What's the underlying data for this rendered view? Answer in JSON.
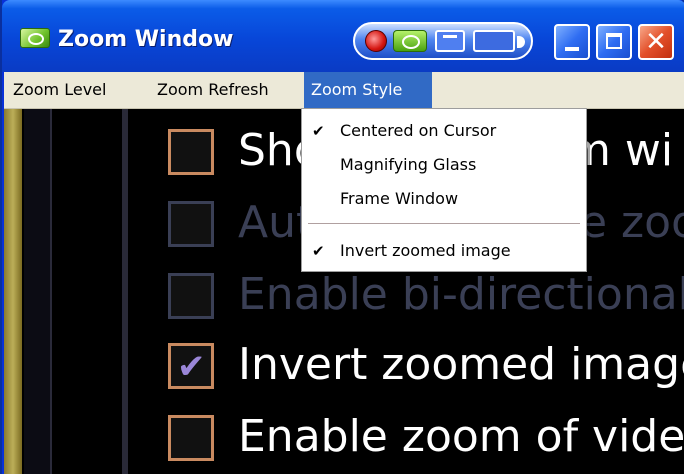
{
  "window": {
    "title": "Zoom Window",
    "app_icon": "nvidia-eye-icon",
    "controls": [
      "record-icon",
      "nvidia-eye-icon",
      "minimize-to-tray-icon",
      "wide-view-icon",
      "minimize-icon",
      "maximize-icon",
      "close-icon"
    ]
  },
  "menubar": {
    "items": [
      {
        "label": "Zoom Level"
      },
      {
        "label": "Zoom Refresh"
      },
      {
        "label": "Zoom Style",
        "active": true
      }
    ]
  },
  "dropdown": {
    "items": [
      {
        "label": "Centered on Cursor",
        "checked": true
      },
      {
        "label": "Magnifying Glass",
        "checked": false
      },
      {
        "label": "Frame Window",
        "checked": false
      },
      {
        "label": "Invert zoomed image",
        "checked": true
      }
    ]
  },
  "zoomed_content": {
    "rows": [
      {
        "text": "Sho",
        "text_tail": "m wi",
        "checked": false,
        "enabled": true
      },
      {
        "text": "Aut",
        "text_tail": "e zoo",
        "checked": false,
        "enabled": false
      },
      {
        "text": "Enable bi-directional edi",
        "checked": false,
        "enabled": false
      },
      {
        "text": "Invert zoomed image",
        "checked": true,
        "enabled": true
      },
      {
        "text": "Enable zoom of video pl",
        "checked": false,
        "enabled": true
      }
    ]
  },
  "colors": {
    "titlebar": "#0846d8",
    "menu_highlight": "#316ac5",
    "menubar_bg": "#ece9d8",
    "zoom_bg": "#000000",
    "checkbox_border_enabled": "#c98a60",
    "checkbox_border_disabled": "#3a3f55",
    "checkmark": "#9a86d8"
  }
}
